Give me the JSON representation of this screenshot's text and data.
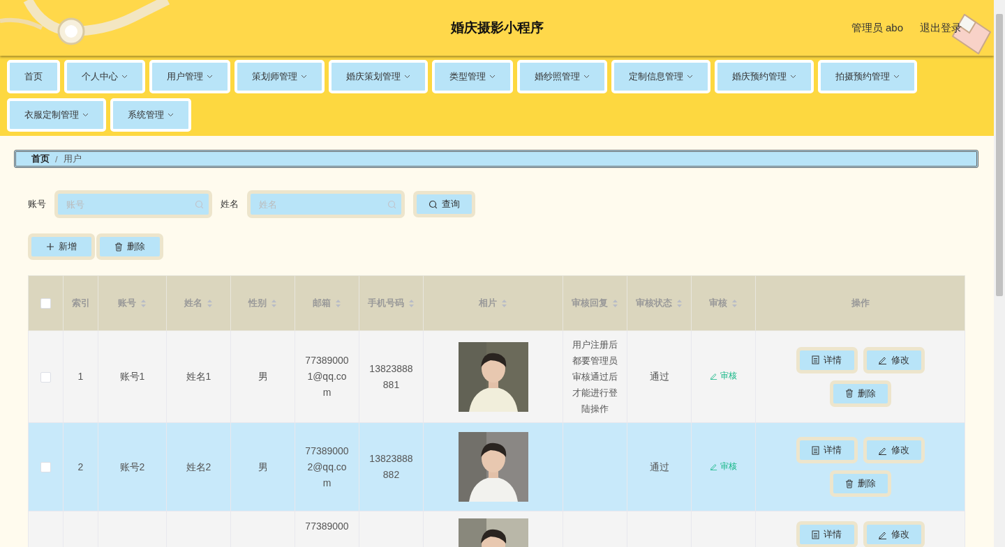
{
  "header": {
    "title": "婚庆摄影小程序",
    "user": "管理员 abo",
    "logout": "退出登录"
  },
  "nav": [
    {
      "label": "首页",
      "dropdown": false
    },
    {
      "label": "个人中心",
      "dropdown": true
    },
    {
      "label": "用户管理",
      "dropdown": true
    },
    {
      "label": "策划师管理",
      "dropdown": true
    },
    {
      "label": "婚庆策划管理",
      "dropdown": true
    },
    {
      "label": "类型管理",
      "dropdown": true
    },
    {
      "label": "婚纱照管理",
      "dropdown": true
    },
    {
      "label": "定制信息管理",
      "dropdown": true
    },
    {
      "label": "婚庆预约管理",
      "dropdown": true
    },
    {
      "label": "拍摄预约管理",
      "dropdown": true
    },
    {
      "label": "衣服定制管理",
      "dropdown": true
    },
    {
      "label": "系统管理",
      "dropdown": true
    }
  ],
  "breadcrumb": [
    "首页",
    "用户"
  ],
  "breadcrumb_separator": "/",
  "search": {
    "fields": [
      {
        "label": "账号",
        "placeholder": "账号"
      },
      {
        "label": "姓名",
        "placeholder": "姓名"
      }
    ],
    "button": "查询"
  },
  "actions": [
    {
      "kind": "add",
      "label": "新增"
    },
    {
      "kind": "delete",
      "label": "删除"
    }
  ],
  "table": {
    "select_all_checked": false,
    "columns": [
      {
        "label": "索引",
        "sortable": false
      },
      {
        "label": "账号",
        "sortable": true
      },
      {
        "label": "姓名",
        "sortable": true
      },
      {
        "label": "性别",
        "sortable": true
      },
      {
        "label": "邮箱",
        "sortable": true
      },
      {
        "label": "手机号码",
        "sortable": true
      },
      {
        "label": "相片",
        "sortable": true
      },
      {
        "label": "审核回复",
        "sortable": true
      },
      {
        "label": "审核状态",
        "sortable": true
      },
      {
        "label": "审核",
        "sortable": true
      },
      {
        "label": "操作",
        "sortable": false
      }
    ],
    "rows": [
      {
        "checked": false,
        "highlighted": false,
        "index": "1",
        "account": "账号1",
        "name": "姓名1",
        "gender": "男",
        "email": "773890001@qq.com",
        "phone": "13823888881",
        "photo": {
          "kind": "picture"
        },
        "reply": "用户注册后都要管理员审核通过后才能进行登陆操作",
        "status": "通过",
        "review": "审核",
        "buttons": [
          {
            "kind": "detail",
            "label": "详情"
          },
          {
            "kind": "edit",
            "label": "修改"
          },
          {
            "kind": "delete",
            "label": "删除"
          }
        ]
      },
      {
        "checked": false,
        "highlighted": true,
        "index": "2",
        "account": "账号2",
        "name": "姓名2",
        "gender": "男",
        "email": "773890002@qq.com",
        "phone": "13823888882",
        "photo": {
          "kind": "picture"
        },
        "status": "通过",
        "review": "审核",
        "buttons": [
          {
            "kind": "detail",
            "label": "详情"
          },
          {
            "kind": "edit",
            "label": "修改"
          },
          {
            "kind": "delete",
            "label": "删除"
          }
        ]
      },
      {
        "highlighted": false,
        "email": "77389000",
        "photo": {
          "kind": "picture"
        },
        "buttons": [
          {
            "kind": "detail",
            "label": "详情"
          },
          {
            "kind": "edit",
            "label": "修改"
          }
        ]
      }
    ]
  }
}
